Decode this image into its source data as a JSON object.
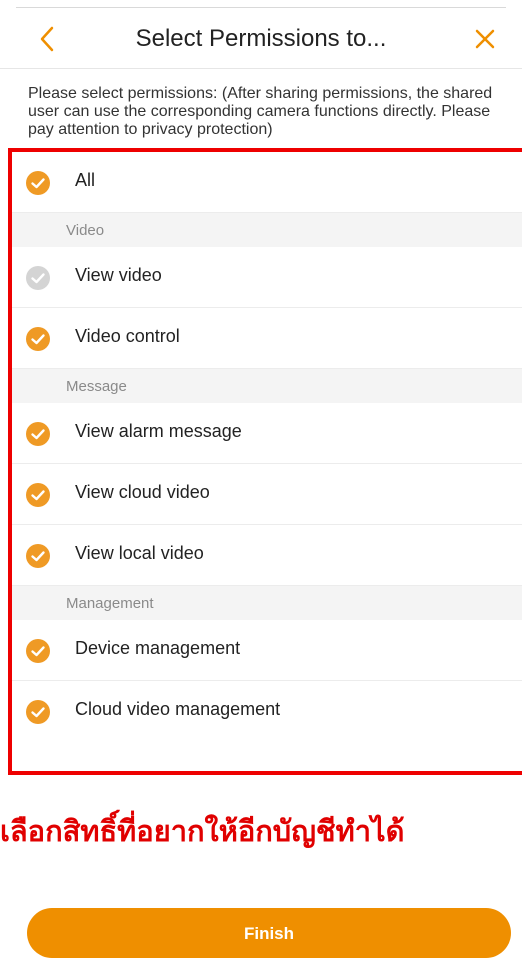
{
  "header": {
    "title": "Select Permissions to...",
    "back_icon": "chevron-left-icon",
    "close_icon": "close-icon",
    "accent_color": "#ef8f00"
  },
  "instructions": "Please select permissions: (After sharing permissions, the shared user can use the corresponding camera functions directly. Please pay attention to privacy protection)",
  "permissions": {
    "all": {
      "label": "All",
      "checked": true
    },
    "video_section": "Video",
    "view_video": {
      "label": "View video",
      "checked": false
    },
    "video_control": {
      "label": "Video control",
      "checked": true
    },
    "message_section": "Message",
    "view_alarm_message": {
      "label": "View alarm message",
      "checked": true
    },
    "view_cloud_video": {
      "label": "View cloud video",
      "checked": true
    },
    "view_local_video": {
      "label": "View local video",
      "checked": true
    },
    "management_section": "Management",
    "device_management": {
      "label": "Device management",
      "checked": true
    },
    "cloud_video_management": {
      "label": "Cloud video management",
      "checked": true
    }
  },
  "annotation": {
    "text": "เลือกสิทธิ์ที่อยากให้อีกบัญชีทำได้",
    "color": "#e00000"
  },
  "finish_label": "Finish",
  "colors": {
    "checked": "#ef9a25",
    "unchecked": "#d4d4d4",
    "highlight_border": "#ee0000"
  }
}
